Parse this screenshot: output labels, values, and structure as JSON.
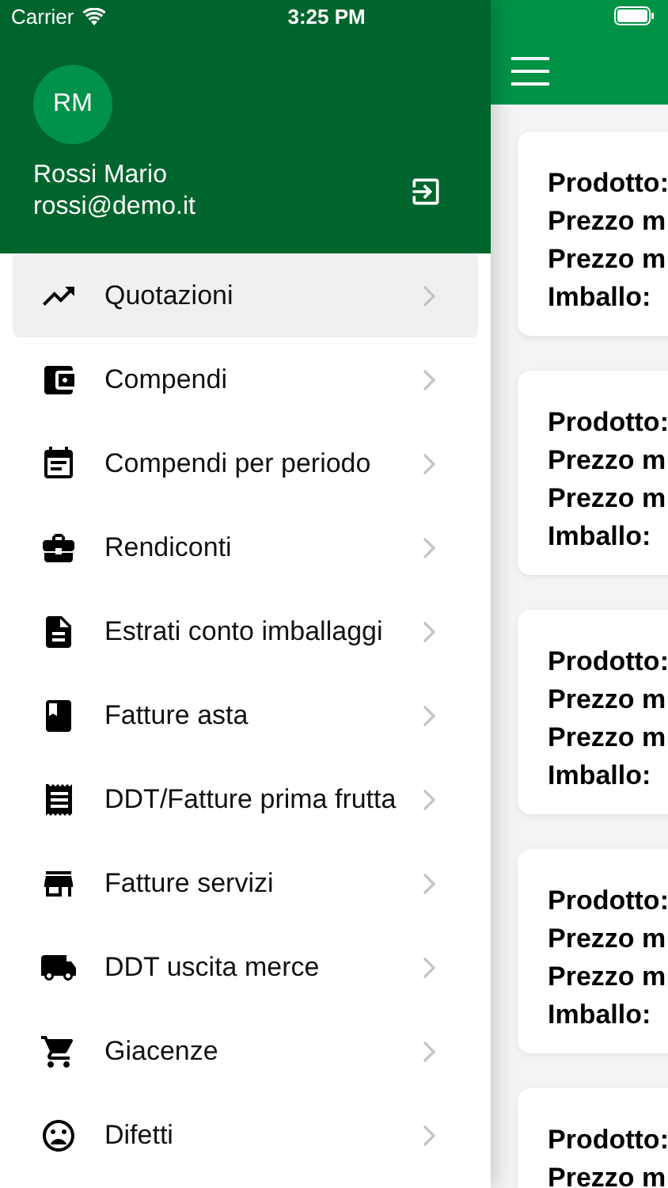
{
  "status_bar": {
    "carrier": "Carrier",
    "time": "3:25 PM"
  },
  "drawer": {
    "user": {
      "initials": "RM",
      "name": "Rossi Mario",
      "email": "rossi@demo.it"
    },
    "items": [
      {
        "label": "Quotazioni",
        "selected": true
      },
      {
        "label": "Compendi",
        "selected": false
      },
      {
        "label": "Compendi per periodo",
        "selected": false
      },
      {
        "label": "Rendiconti",
        "selected": false
      },
      {
        "label": "Estrati conto imballaggi",
        "selected": false
      },
      {
        "label": "Fatture asta",
        "selected": false
      },
      {
        "label": "DDT/Fatture prima frutta",
        "selected": false
      },
      {
        "label": "Fatture servizi",
        "selected": false
      },
      {
        "label": "DDT uscita merce",
        "selected": false
      },
      {
        "label": "Giacenze",
        "selected": false
      },
      {
        "label": "Difetti",
        "selected": false
      }
    ]
  },
  "cards": [
    {
      "lines": [
        "Prodotto:",
        "Prezzo m",
        "Prezzo m",
        "Imballo:"
      ]
    },
    {
      "lines": [
        "Prodotto:",
        "Prezzo m",
        "Prezzo m",
        "Imballo:"
      ]
    },
    {
      "lines": [
        "Prodotto:",
        "Prezzo m",
        "Prezzo m",
        "Imballo:"
      ]
    },
    {
      "lines": [
        "Prodotto:",
        "Prezzo m",
        "Prezzo m",
        "Imballo:"
      ]
    },
    {
      "lines": [
        "Prodotto:",
        "Prezzo m"
      ]
    }
  ]
}
